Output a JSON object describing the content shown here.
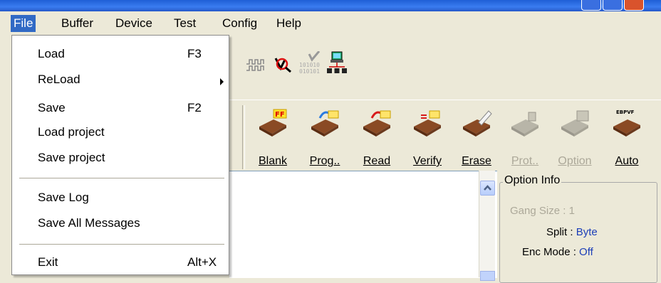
{
  "menubar": {
    "items": [
      {
        "label": "File",
        "active": true
      },
      {
        "label": "Buffer"
      },
      {
        "label": "Device"
      },
      {
        "label": "Test"
      },
      {
        "label": "Config"
      },
      {
        "label": "Help"
      }
    ]
  },
  "file_menu": {
    "items": [
      {
        "label": "Load",
        "shortcut": "F3"
      },
      {
        "label": "ReLoad",
        "submenu": true
      },
      {
        "label": "Save",
        "shortcut": "F2"
      },
      {
        "label": "Load project"
      },
      {
        "label": "Save project"
      },
      {
        "label": "Save Log"
      },
      {
        "label": "Save All Messages"
      },
      {
        "label": "Exit",
        "shortcut": "Alt+X"
      }
    ]
  },
  "small_toolbar": {
    "icons": [
      "waveform-icon",
      "inspect-chip-icon",
      "binary-check-icon",
      "network-programmer-icon"
    ],
    "binary_text": [
      "101010",
      "010101"
    ]
  },
  "main_toolbar": {
    "buttons": [
      {
        "label": "Blank",
        "icon": "blank-chip-icon",
        "badge": "FF",
        "enabled": true
      },
      {
        "label": "Prog..",
        "icon": "program-chip-icon",
        "enabled": true
      },
      {
        "label": "Read",
        "icon": "read-chip-icon",
        "enabled": true
      },
      {
        "label": "Verify",
        "icon": "verify-chip-icon",
        "enabled": true
      },
      {
        "label": "Erase",
        "icon": "erase-chip-icon",
        "enabled": true
      },
      {
        "label": "Prot..",
        "icon": "protect-chip-icon",
        "enabled": false
      },
      {
        "label": "Option",
        "icon": "option-chip-icon",
        "enabled": false
      },
      {
        "label": "Auto",
        "icon": "auto-chip-icon",
        "badge": "EBPVF",
        "enabled": true
      }
    ]
  },
  "option_info": {
    "title": "Option Info",
    "rows": [
      {
        "label": "Gang Size :",
        "value": "1",
        "dim": true
      },
      {
        "label": "Split :",
        "value": "Byte",
        "dim": false
      },
      {
        "label": "Enc Mode :",
        "value": "Off",
        "dim": false
      }
    ]
  },
  "colors": {
    "menu_highlight": "#316ac5",
    "value_blue": "#1c3eb8",
    "disabled_text": "#aca899",
    "chip_brown": "#6b3a1e"
  }
}
